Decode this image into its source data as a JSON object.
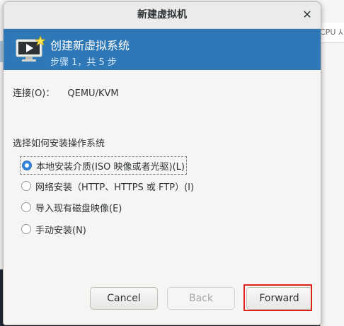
{
  "background": {
    "column_label": "CPU ⅄"
  },
  "dialog": {
    "title": "新建虚拟机",
    "close_glyph": "✕"
  },
  "banner": {
    "title": "创建新虚拟系统",
    "subtitle": "步骤 1，共 5 步",
    "icon": "monitor-star-icon"
  },
  "connection": {
    "label": "连接(O)：",
    "value": "QEMU/KVM"
  },
  "install_method": {
    "label": "选择如何安装操作系统",
    "options": [
      {
        "label": "本地安装介质(ISO 映像或者光驱)(L)",
        "selected": true
      },
      {
        "label": "网络安装（HTTP、HTTPS 或 FTP）(I)",
        "selected": false
      },
      {
        "label": "导入现有磁盘映像(E)",
        "selected": false
      },
      {
        "label": "手动安装(N)",
        "selected": false
      }
    ]
  },
  "buttons": {
    "cancel": "Cancel",
    "back": "Back",
    "forward": "Forward"
  },
  "colors": {
    "banner": "#2f78b7",
    "highlight": "#e0201b",
    "radio_accent": "#3584e4"
  }
}
